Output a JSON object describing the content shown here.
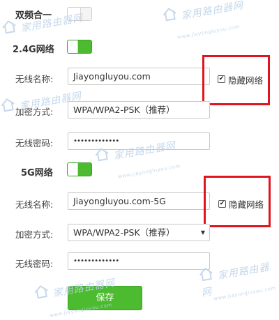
{
  "dual_band": {
    "label": "双频合一",
    "enabled": false
  },
  "band_24g": {
    "label": "2.4G网络",
    "enabled": true,
    "ssid_label": "无线名称:",
    "ssid_value": "Jiayongluyou.com",
    "hide_label": "隐藏网络",
    "hide_checked": true,
    "security_label": "加密方式:",
    "security_value": "WPA/WPA2-PSK（推荐）",
    "password_label": "无线密码:",
    "password_value": "•••••••••••••"
  },
  "band_5g": {
    "label": "5G网络",
    "enabled": true,
    "ssid_label": "无线名称:",
    "ssid_value": "Jiayongluyou.com-5G",
    "hide_label": "隐藏网络",
    "hide_checked": true,
    "security_label": "加密方式:",
    "security_value": "WPA/WPA2-PSK（推荐）",
    "password_label": "无线密码:",
    "password_value": "•••••••••••••"
  },
  "save_label": "保存",
  "checkmark": "✔",
  "select_arrow": "▼",
  "watermark": {
    "text": "家用路由器网",
    "sub": "www.jiayongluyou.com"
  },
  "colors": {
    "accent_green": "#4cbb2f",
    "highlight_red": "#e0141e",
    "watermark_blue": "#bcd2ea"
  }
}
